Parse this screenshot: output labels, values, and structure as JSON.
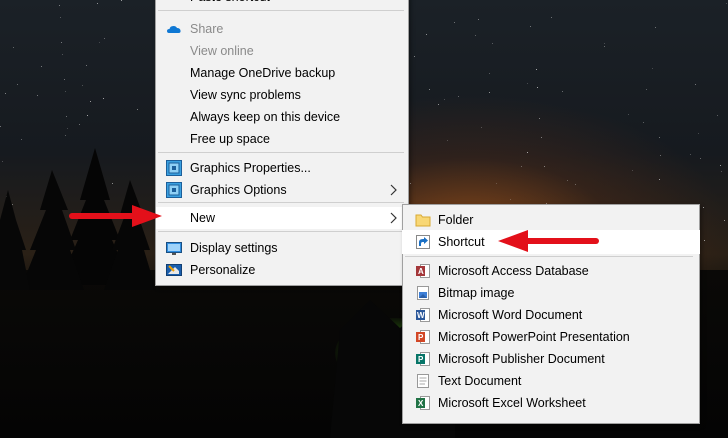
{
  "context_menu": {
    "top_clipped_label": "Paste shortcut",
    "share_label": "Share",
    "view_online_label": "View online",
    "manage_backup_label": "Manage OneDrive backup",
    "view_sync_label": "View sync problems",
    "always_keep_label": "Always keep on this device",
    "free_up_label": "Free up space",
    "graphics_properties_label": "Graphics Properties...",
    "graphics_options_label": "Graphics Options",
    "new_label": "New",
    "display_settings_label": "Display settings",
    "personalize_label": "Personalize"
  },
  "new_submenu": {
    "folder_label": "Folder",
    "shortcut_label": "Shortcut",
    "access_label": "Microsoft Access Database",
    "bitmap_label": "Bitmap image",
    "word_label": "Microsoft Word Document",
    "powerpoint_label": "Microsoft PowerPoint Presentation",
    "publisher_label": "Microsoft Publisher Document",
    "text_label": "Text Document",
    "excel_label": "Microsoft Excel Worksheet"
  },
  "colors": {
    "annotation_arrow": "#e3101a",
    "menu_background": "#f2f2f2",
    "menu_hover": "#ffffff",
    "disabled_text": "#8a8a8a"
  },
  "icons": {
    "share": "onedrive-cloud-icon",
    "graphics_properties": "intel-graphics-icon",
    "graphics_options": "intel-graphics-icon",
    "display_settings": "monitor-icon",
    "personalize": "personalize-icon",
    "folder": "folder-icon",
    "shortcut": "shortcut-icon",
    "access": "access-icon",
    "bitmap": "bitmap-icon",
    "word": "word-icon",
    "powerpoint": "powerpoint-icon",
    "publisher": "publisher-icon",
    "text": "text-document-icon",
    "excel": "excel-icon"
  }
}
